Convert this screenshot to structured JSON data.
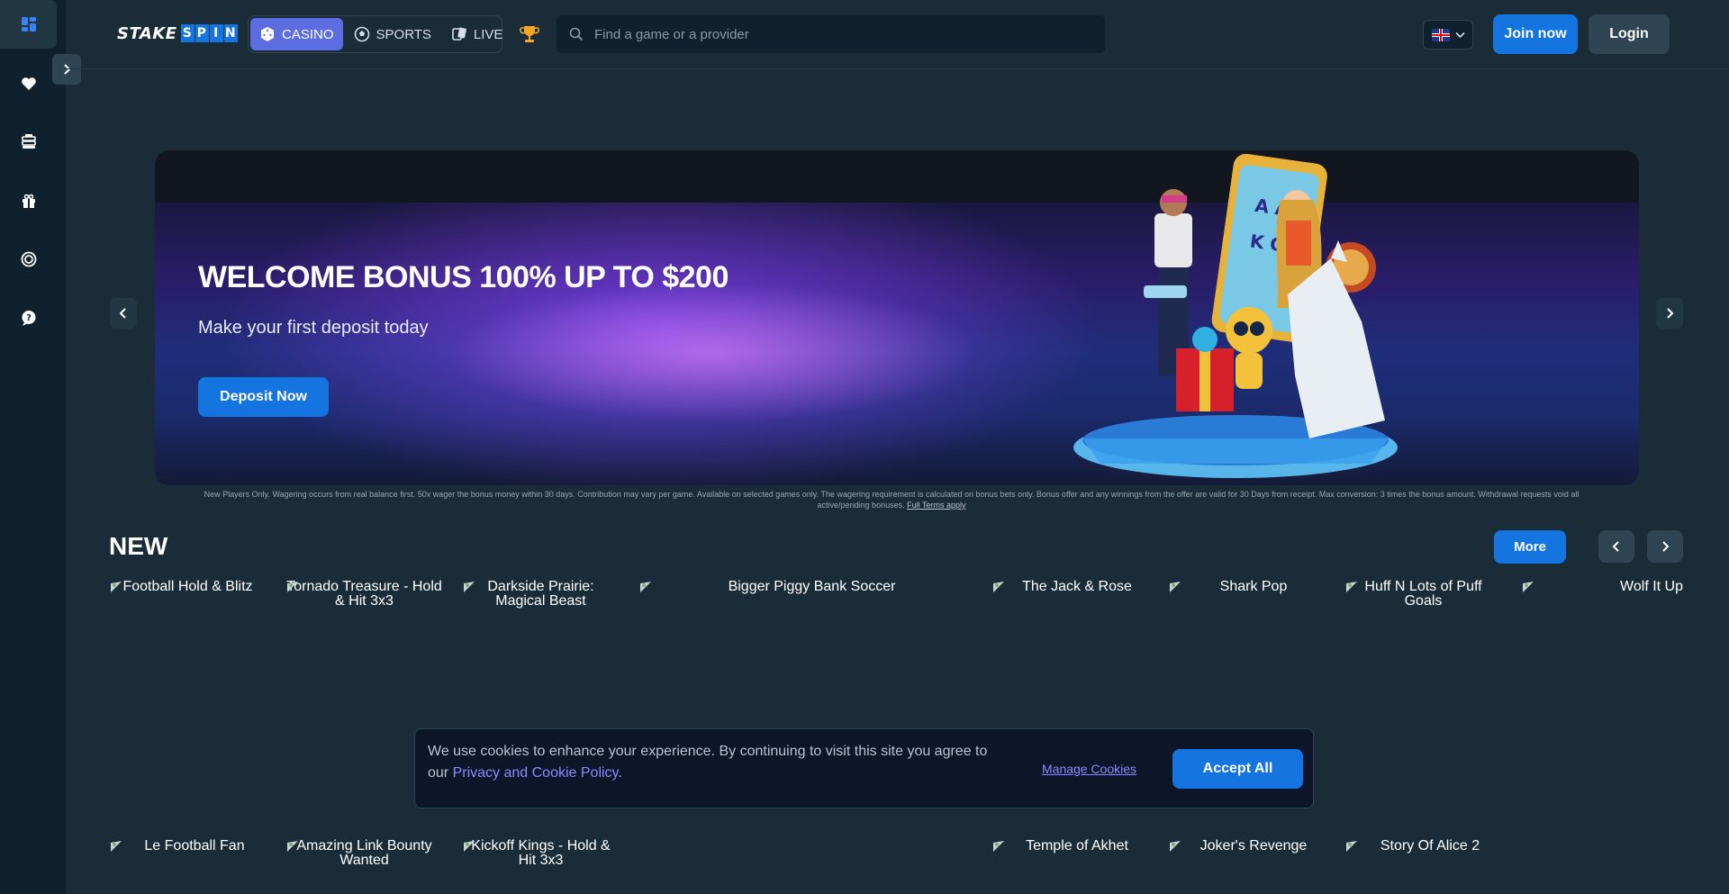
{
  "header": {
    "logo_stake": "STAKE",
    "logo_spin": [
      "S",
      "P",
      "I",
      "N"
    ],
    "modes": [
      {
        "label": "Casino",
        "icon": "dice-icon",
        "active": true
      },
      {
        "label": "Sports",
        "icon": "soccer-ball-icon",
        "active": false
      },
      {
        "label": "Live",
        "icon": "cards-icon",
        "active": false
      }
    ],
    "search_placeholder": "Find a game or a provider",
    "language_icon": "uk-flag-icon",
    "join_label": "Join now",
    "login_label": "Login"
  },
  "sidebar": {
    "items": [
      "grid-icon",
      "heart-icon",
      "casino-chips-icon",
      "gift-icon",
      "target-icon",
      "support-chat-icon"
    ]
  },
  "banner": {
    "title": "WELCOME BONUS 100% UP TO $200",
    "subtitle": "Make your first deposit today",
    "cta_label": "Deposit Now",
    "terms": "New Players Only. Wagering occurs from real balance first. 50x wager the bonus money within 30 days. Contribution may vary per game. Available on selected games only. The wagering requirement is calculated on bonus bets only. Bonus offer and any winnings from the offer are valid for 30 Days from receipt. Max conversion: 3 times the bonus amount. Withdrawal requests void all active/pending bonuses.",
    "terms_link": "Full Terms apply"
  },
  "new_section": {
    "title": "NEW",
    "more_label": "More",
    "row1": [
      "Football Hold & Blitz",
      "Tornado Treasure - Hold & Hit 3x3",
      "Darkside Prairie: Magical Beast",
      "Bigger Piggy Bank Soccer",
      "The Jack & Rose",
      "Shark Pop",
      "Huff N Lots of Puff Goals",
      "Wolf It Up"
    ],
    "row2": [
      "Le Football Fan",
      "Amazing Link Bounty Wanted",
      "Kickoff Kings - Hold & Hit 3x3",
      "Temple of Akhet",
      "Joker's Revenge",
      "Story Of Alice 2"
    ]
  },
  "cookie": {
    "text": "We use cookies to enhance your experience. By continuing to visit this site you agree to our ",
    "policy_link": "Privacy and Cookie Policy",
    "period": ".",
    "manage_label": "Manage Cookies",
    "accept_label": "Accept All"
  },
  "colors": {
    "accent": "#1475e1",
    "casino_active": "#5b6de0",
    "background": "#1a2c38",
    "sidebar": "#0f212e"
  }
}
